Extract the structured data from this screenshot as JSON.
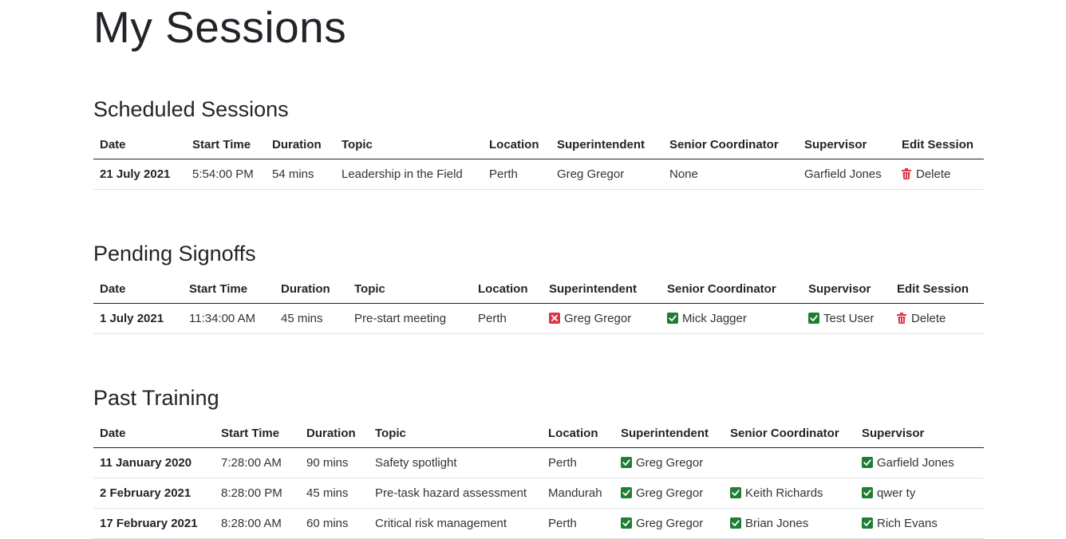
{
  "page": {
    "title": "My Sessions"
  },
  "scheduled": {
    "heading": "Scheduled Sessions",
    "columns": [
      "Date",
      "Start Time",
      "Duration",
      "Topic",
      "Location",
      "Superintendent",
      "Senior Coordinator",
      "Supervisor",
      "Edit Session"
    ],
    "rows": [
      {
        "date": "21 July 2021",
        "start": "5:54:00 PM",
        "duration": "54 mins",
        "topic": "Leadership in the Field",
        "location": "Perth",
        "superintendent": "Greg Gregor",
        "coordinator": "None",
        "supervisor": "Garfield Jones",
        "action": "Delete"
      }
    ]
  },
  "pending": {
    "heading": "Pending Signoffs",
    "columns": [
      "Date",
      "Start Time",
      "Duration",
      "Topic",
      "Location",
      "Superintendent",
      "Senior Coordinator",
      "Supervisor",
      "Edit Session"
    ],
    "rows": [
      {
        "date": "1 July 2021",
        "start": "11:34:00 AM",
        "duration": "45 mins",
        "topic": "Pre-start meeting",
        "location": "Perth",
        "superintendent": "Greg Gregor",
        "superintendent_status": "rejected",
        "coordinator": "Mick Jagger",
        "coordinator_status": "approved",
        "supervisor": "Test User",
        "supervisor_status": "approved",
        "action": "Delete"
      }
    ]
  },
  "past": {
    "heading": "Past Training",
    "columns": [
      "Date",
      "Start Time",
      "Duration",
      "Topic",
      "Location",
      "Superintendent",
      "Senior Coordinator",
      "Supervisor"
    ],
    "rows": [
      {
        "date": "11 January 2020",
        "start": "7:28:00 AM",
        "duration": "90 mins",
        "topic": "Safety spotlight",
        "location": "Perth",
        "superintendent": "Greg Gregor",
        "coordinator": "",
        "supervisor": "Garfield Jones"
      },
      {
        "date": "2 February 2021",
        "start": "8:28:00 PM",
        "duration": "45 mins",
        "topic": "Pre-task hazard assessment",
        "location": "Mandurah",
        "superintendent": "Greg Gregor",
        "coordinator": "Keith Richards",
        "supervisor": "qwer ty"
      },
      {
        "date": "17 February 2021",
        "start": "8:28:00 AM",
        "duration": "60 mins",
        "topic": "Critical risk management",
        "location": "Perth",
        "superintendent": "Greg Gregor",
        "coordinator": "Brian Jones",
        "supervisor": "Rich Evans"
      }
    ]
  },
  "colors": {
    "approved": "#1e7e34",
    "rejected": "#dc3545",
    "trash": "#dc3545"
  }
}
